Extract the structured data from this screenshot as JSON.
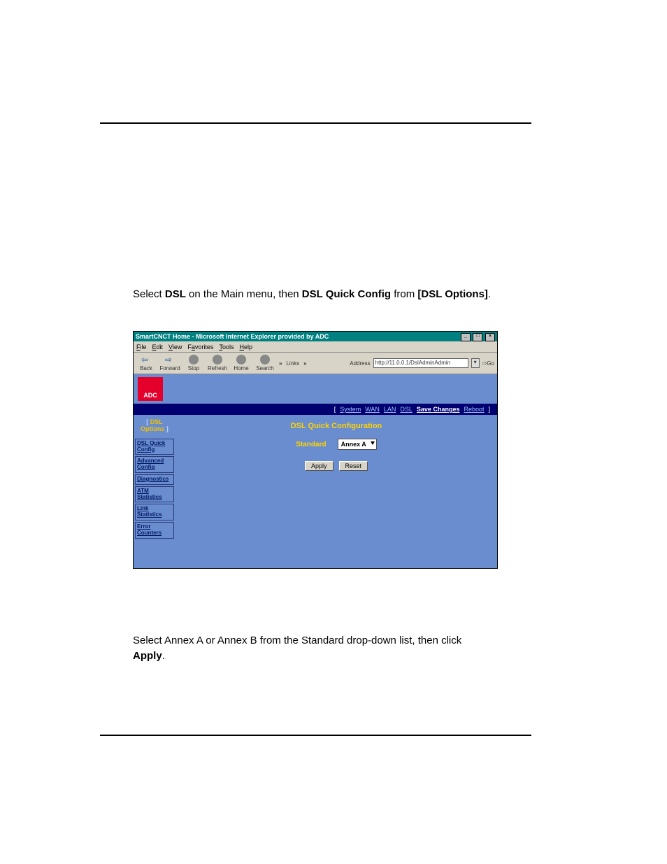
{
  "step1": {
    "prefix": "Select ",
    "dsl": "DSL",
    "mid1": " on the Main menu, then ",
    "quick": "DSL Quick Config",
    "mid2": " from ",
    "options": "[DSL Options]",
    "tail": "."
  },
  "step2a": "Select Annex A or Annex B from the Standard drop-down list, then click ",
  "step2b": "Apply",
  "step2c": ".",
  "browser": {
    "title": "SmartCNCT Home - Microsoft Internet Explorer provided by ADC",
    "menu": {
      "file": "File",
      "edit": "Edit",
      "view": "View",
      "fav": "Favorites",
      "tools": "Tools",
      "help": "Help"
    },
    "toolbar": {
      "back": "Back",
      "forward": "Forward",
      "stop": "Stop",
      "refresh": "Refresh",
      "home": "Home",
      "search": "Search",
      "links": "Links",
      "address": "Address",
      "go": "Go"
    },
    "url": "http://11.0.0.1/DslAdminAdmin",
    "logo": "ADC",
    "topnav": {
      "system": "System",
      "wan": "WAN",
      "lan": "LAN",
      "dsl": "DSL",
      "save": "Save Changes",
      "reboot": "Reboot"
    },
    "sidebar": {
      "head_line1": "[ DSL",
      "head_line2": "Options ]",
      "links": [
        "DSL Quick Config",
        "Advanced Config",
        "Diagnostics",
        "ATM Statistics",
        "Link Statistics",
        "Error Counters"
      ]
    },
    "main": {
      "title": "DSL Quick Configuration",
      "label": "Standard",
      "select": "Annex A",
      "apply": "Apply",
      "reset": "Reset"
    }
  }
}
